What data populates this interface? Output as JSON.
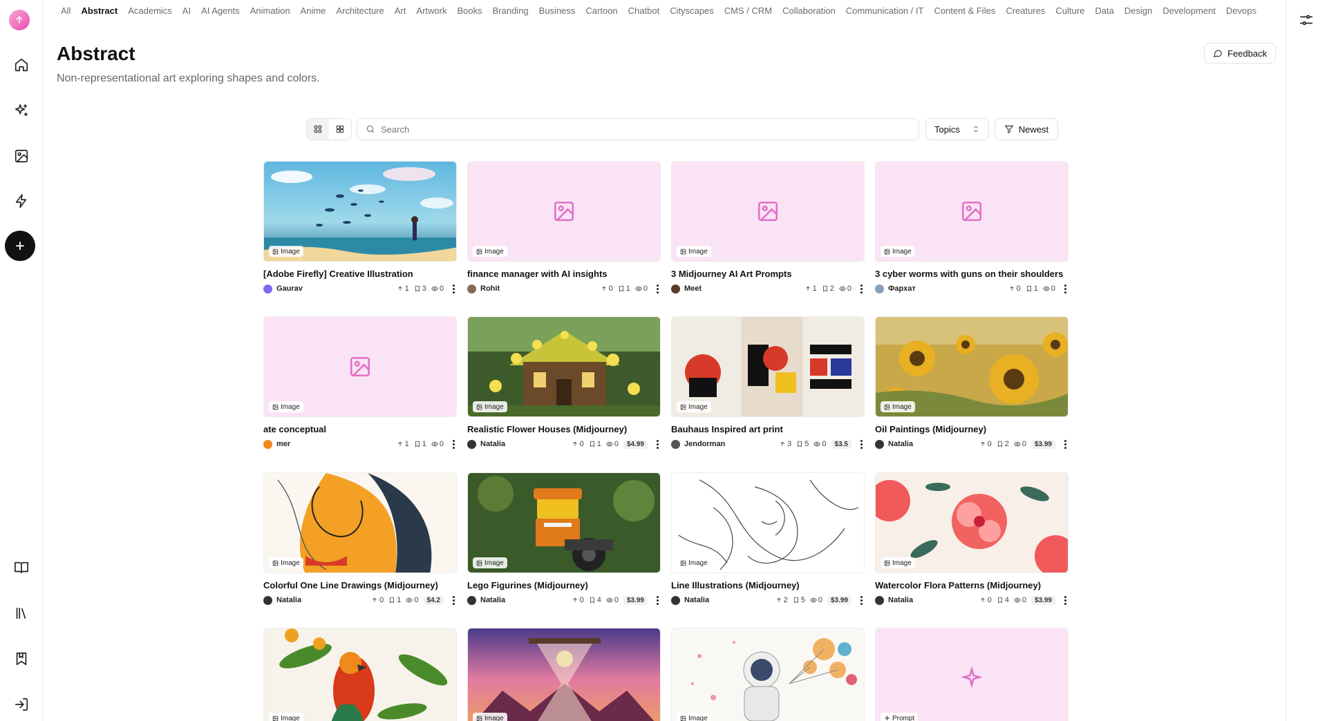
{
  "categories": [
    "All",
    "Abstract",
    "Academics",
    "AI",
    "AI Agents",
    "Animation",
    "Anime",
    "Architecture",
    "Art",
    "Artwork",
    "Books",
    "Branding",
    "Business",
    "Cartoon",
    "Chatbot",
    "Cityscapes",
    "CMS / CRM",
    "Collaboration",
    "Communication / IT",
    "Content & Files",
    "Creatures",
    "Culture",
    "Data",
    "Design",
    "Development",
    "Devops"
  ],
  "active_category": "Abstract",
  "page": {
    "title": "Abstract",
    "subtitle": "Non-representational art exploring shapes and colors.",
    "feedback_label": "Feedback"
  },
  "toolbar": {
    "search_placeholder": "Search",
    "search_value": "",
    "topics_label": "Topics",
    "sort_label": "Newest"
  },
  "icons": {
    "sidebar": [
      "logo-icon",
      "home-icon",
      "sparkles-icon",
      "image-icon",
      "zap-icon",
      "plus-icon",
      "book-open-icon",
      "library-icon",
      "bookmark-icon",
      "log-in-icon"
    ],
    "right": "sliders-icon"
  },
  "colors": {
    "placeholder_bg": "#fbe3f6",
    "placeholder_icon": "#e070c6",
    "brand": "#ea4fae"
  },
  "cards": [
    {
      "title": "[Adobe Firefly] Creative Illustration",
      "type": "Image",
      "author": "Gaurav",
      "upvotes": "1",
      "saves": "3",
      "views": "0",
      "price": "",
      "art": "fish",
      "avatar_color": "#7a6af0"
    },
    {
      "title": "finance manager with AI insights",
      "type": "Image",
      "author": "Rohit",
      "upvotes": "0",
      "saves": "1",
      "views": "0",
      "price": "",
      "art": "placeholder",
      "avatar_color": "#8a6a52"
    },
    {
      "title": "3 Midjourney AI Art Prompts",
      "type": "Image",
      "author": "Meet",
      "upvotes": "1",
      "saves": "2",
      "views": "0",
      "price": "",
      "art": "placeholder",
      "avatar_color": "#5a3a2a"
    },
    {
      "title": "3 cyber worms with guns on their shoulders",
      "type": "Image",
      "author": "Фархат",
      "upvotes": "0",
      "saves": "1",
      "views": "0",
      "price": "",
      "art": "placeholder",
      "avatar_color": "#8aa0b8"
    },
    {
      "title": "ate conceptual",
      "type": "Image",
      "author": "mer",
      "upvotes": "1",
      "saves": "1",
      "views": "0",
      "price": "",
      "art": "placeholder",
      "avatar_color": "#f08a1e"
    },
    {
      "title": "Realistic Flower Houses (Midjourney)",
      "type": "Image",
      "author": "Natalia",
      "upvotes": "0",
      "saves": "1",
      "views": "0",
      "price": "$4.99",
      "art": "flowerhouse",
      "avatar_color": "#333333"
    },
    {
      "title": "Bauhaus Inspired art print",
      "type": "Image",
      "author": "Jendorman",
      "upvotes": "3",
      "saves": "5",
      "views": "0",
      "price": "$3.5",
      "art": "bauhaus",
      "avatar_color": "#555555"
    },
    {
      "title": "Oil Paintings (Midjourney)",
      "type": "Image",
      "author": "Natalia",
      "upvotes": "0",
      "saves": "2",
      "views": "0",
      "price": "$3.99",
      "art": "sunflower",
      "avatar_color": "#333333"
    },
    {
      "title": "Colorful One Line Drawings (Midjourney)",
      "type": "Image",
      "author": "Natalia",
      "upvotes": "0",
      "saves": "1",
      "views": "0",
      "price": "$4.2",
      "art": "oneline",
      "avatar_color": "#333333"
    },
    {
      "title": "Lego Figurines (Midjourney)",
      "type": "Image",
      "author": "Natalia",
      "upvotes": "0",
      "saves": "4",
      "views": "0",
      "price": "$3.99",
      "art": "lego",
      "avatar_color": "#333333"
    },
    {
      "title": "Line Illustrations (Midjourney)",
      "type": "Image",
      "author": "Natalia",
      "upvotes": "2",
      "saves": "5",
      "views": "0",
      "price": "$3.99",
      "art": "lineart",
      "avatar_color": "#333333"
    },
    {
      "title": "Watercolor Flora Patterns (Midjourney)",
      "type": "Image",
      "author": "Natalia",
      "upvotes": "0",
      "saves": "4",
      "views": "0",
      "price": "$3.99",
      "art": "hibiscus",
      "avatar_color": "#333333"
    },
    {
      "title": "",
      "type": "Image",
      "author": "",
      "upvotes": "",
      "saves": "",
      "views": "",
      "price": "",
      "art": "parrot",
      "avatar_color": ""
    },
    {
      "title": "",
      "type": "Image",
      "author": "",
      "upvotes": "",
      "saves": "",
      "views": "",
      "price": "",
      "art": "hourglass",
      "avatar_color": ""
    },
    {
      "title": "",
      "type": "Image",
      "author": "",
      "upvotes": "",
      "saves": "",
      "views": "",
      "price": "",
      "art": "astronaut",
      "avatar_color": ""
    },
    {
      "title": "",
      "type": "Prompt",
      "author": "",
      "upvotes": "",
      "saves": "",
      "views": "",
      "price": "",
      "art": "prompt",
      "avatar_color": ""
    }
  ]
}
